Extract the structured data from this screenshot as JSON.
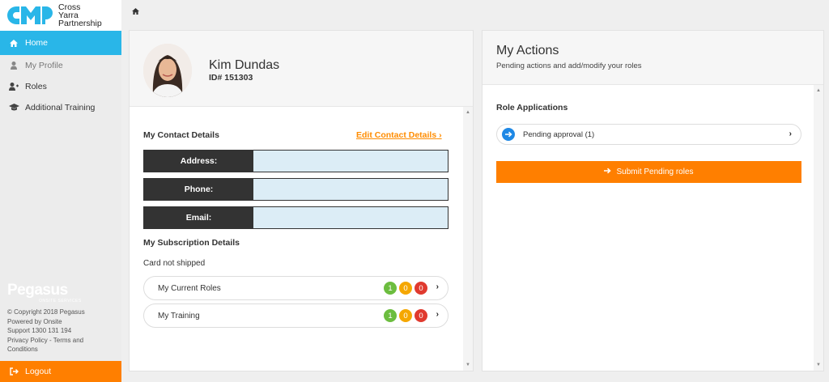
{
  "logo": {
    "line1": "Cross",
    "line2": "Yarra",
    "line3": "Partnership"
  },
  "sidebar": {
    "items": [
      {
        "label": "Home"
      },
      {
        "label": "My Profile"
      },
      {
        "label": "Roles"
      },
      {
        "label": "Additional Training"
      }
    ],
    "brand": "Pegasus",
    "brand_sub": "ONSITE SERVICES",
    "footer": {
      "copyright": "© Copyright 2018 Pegasus",
      "powered": "Powered by Onsite",
      "support": "Support 1300 131 194",
      "policy": "Privacy Policy - Terms and",
      "conditions": "Conditions"
    },
    "logout": "Logout"
  },
  "profile": {
    "name": "Kim Dundas",
    "id": "ID# 151303"
  },
  "contact": {
    "title": "My Contact Details",
    "edit_link": "Edit Contact Details",
    "fields": [
      {
        "label": "Address:",
        "value": ""
      },
      {
        "label": "Phone:",
        "value": ""
      },
      {
        "label": "Email:",
        "value": ""
      }
    ]
  },
  "subscription": {
    "title": "My Subscription Details",
    "card_status": "Card not shipped",
    "rows": [
      {
        "label": "My Current Roles",
        "counts": [
          "1",
          "0",
          "0"
        ]
      },
      {
        "label": "My Training",
        "counts": [
          "1",
          "0",
          "0"
        ]
      }
    ]
  },
  "actions": {
    "title": "My Actions",
    "subtitle": "Pending actions and add/modify your roles",
    "section_title": "Role Applications",
    "pending_label": "Pending approval (1)",
    "submit_label": "Submit Pending roles"
  },
  "colors": {
    "accent": "#29b6e8",
    "orange": "#ff7f00",
    "green": "#6cbd3f",
    "amber": "#f5a700",
    "red": "#e03a2f"
  }
}
